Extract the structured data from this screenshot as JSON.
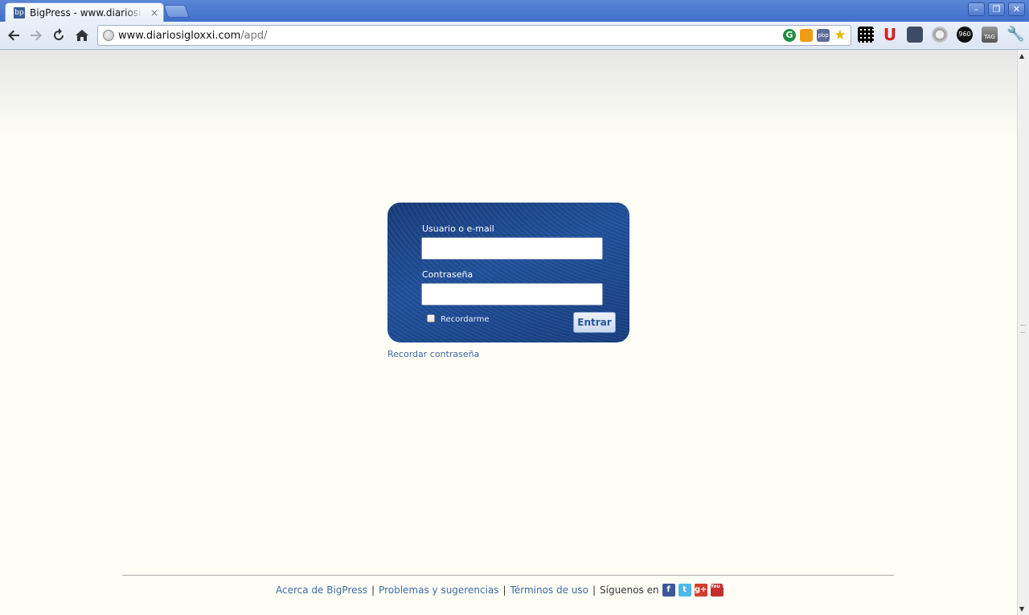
{
  "browser": {
    "tab_title": "BigPress - www.diariosigloxxi.com",
    "tab_favicon": "bp",
    "tab_close": "×",
    "window_min": "–",
    "window_max": "❐",
    "window_close": "✕"
  },
  "toolbar": {
    "url_host": "www.diariosigloxxi.com",
    "url_path": "/apd/",
    "ext_g": "G",
    "ext_pbp": "pbp",
    "ext_star": "★",
    "ext_magnet": "U",
    "ext_960": "960",
    "ext_tag": "TAG",
    "ext_wrench": "🔧"
  },
  "login": {
    "user_label": "Usuario o e-mail",
    "user_value": "",
    "password_label": "Contraseña",
    "password_value": "",
    "remember_label": "Recordarme",
    "submit_label": "Entrar",
    "forgot_link": "Recordar contraseña"
  },
  "footer": {
    "about": "Acerca de BigPress",
    "problems": "Problemas y sugerencias",
    "terms": "Términos de uso",
    "follow": "Síguenos en",
    "separator": "|",
    "social": {
      "facebook": "f",
      "twitter": "t",
      "googleplus": "g+",
      "youtube": "You Tube"
    }
  },
  "colors": {
    "login_box": "#1f4f98",
    "link": "#3d6aa7",
    "page_bg": "#fefef6"
  }
}
